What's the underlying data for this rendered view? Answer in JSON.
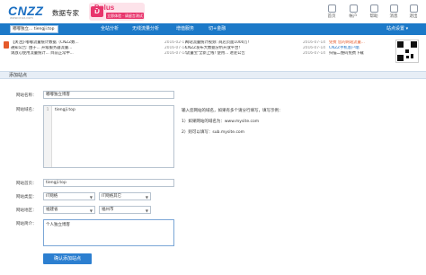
{
  "header": {
    "logo": "CNZZ",
    "logo_sub": "www.cnzz.com",
    "product": "数据专家",
    "promo": {
      "badge": "D",
      "title": "Dplus",
      "tag": "立即体验 · 请留言测试"
    },
    "nav": [
      {
        "label": "首页",
        "icon": "home-icon"
      },
      {
        "label": "帐户",
        "icon": "user-icon"
      },
      {
        "label": "帮助",
        "icon": "help-icon"
      },
      {
        "label": "消息",
        "icon": "message-icon"
      },
      {
        "label": "退出",
        "icon": "logout-icon"
      }
    ]
  },
  "navbar": {
    "site_select": "嘟嘟独立... tiengji.top",
    "items": [
      "全站分析",
      "无线流量分析",
      "增值服务",
      "切+金融"
    ],
    "right": "站点设置 ▾"
  },
  "news": {
    "left": [
      {
        "text": "【关注】·嘟嘟流量统计数据（CNZZ数...",
        "date": "2016-02-17"
      },
      {
        "text": "通知公告: 由于... 升级服务器流量...",
        "date": "2016-07-14"
      },
      {
        "text": "请放心使用流量统计... 目前正常中...",
        "date": "2016-07-14"
      }
    ],
    "right": [
      {
        "text": "网站流量统计视频: 商店页面1000万!",
        "date": "2016-07-14"
      },
      {
        "text": "CNZZ发布大数据分析开放平台!",
        "date": "2016-07-14"
      },
      {
        "text": "'流量宝'全新上线! 使用... 进驻公告",
        "date": "2016-07-14"
      }
    ],
    "ad": [
      "免费 您的网站流量...",
      "CNZZ手机客户端",
      "扫描二维码免费下载"
    ]
  },
  "section_title": "添加站点",
  "form": {
    "site_name_label": "网站名称：",
    "site_name_value": "嘟嘟独立博客",
    "domain_label": "网站域名：",
    "domain_line_no": "1",
    "domain_value": "tiengji.top",
    "hint_title": "输入您网站的域名，如果有多个请分行填写，填写示例：",
    "hint_1": "1）如果网站的域名为：www.mysite.com",
    "hint_2": "2）则可以填写：sub.mysite.com",
    "homepage_label": "网站首页：",
    "homepage_value": "tiengji.top",
    "type_label": "网站类型：",
    "type_value_1": "IT网络",
    "type_value_2": "IT网络其它",
    "region_label": "网站地区：",
    "region_value_1": "福建省",
    "region_value_2": "福州市",
    "intro_label": "网站简介：",
    "intro_value": "个人独立博客",
    "submit": "确认添加站点"
  }
}
